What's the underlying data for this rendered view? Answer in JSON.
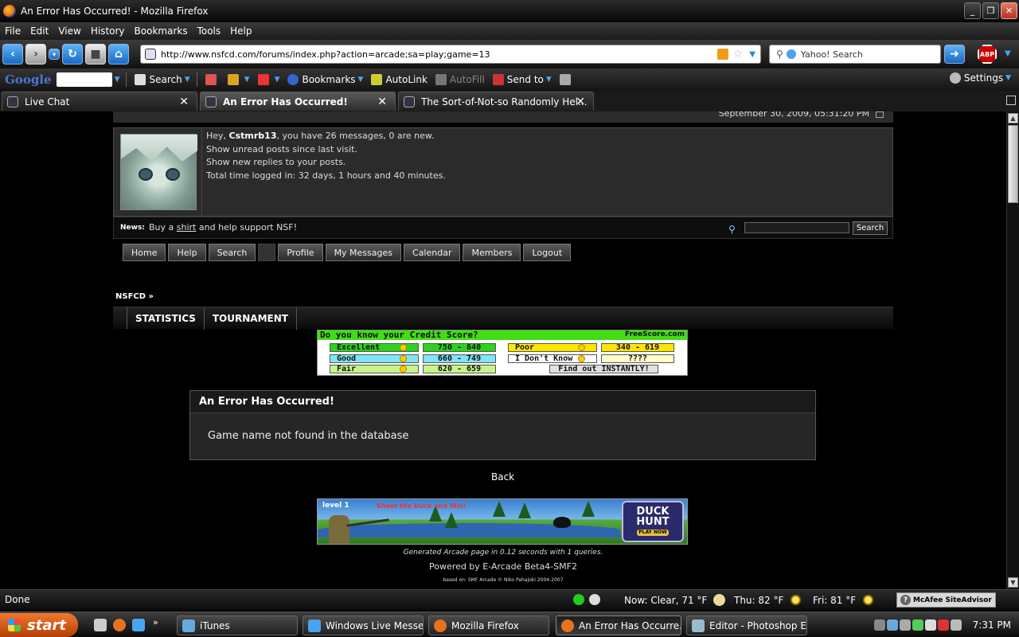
{
  "window": {
    "title": "An Error Has Occurred! - Mozilla Firefox"
  },
  "menu": [
    "File",
    "Edit",
    "View",
    "History",
    "Bookmarks",
    "Tools",
    "Help"
  ],
  "nav": {
    "url": "http://www.nsfcd.com/forums/index.php?action=arcade;sa=play;game=13",
    "search_placeholder": "Yahoo! Search"
  },
  "google_toolbar": {
    "logo": "Google",
    "search": "Search",
    "bookmarks": "Bookmarks",
    "autolink": "AutoLink",
    "autofill": "AutoFill",
    "sendto": "Send to",
    "settings": "Settings"
  },
  "tabs": [
    {
      "label": "Live Chat",
      "active": false
    },
    {
      "label": "An Error Has Occurred!",
      "active": true
    },
    {
      "label": "The Sort-of-Not-so Randomly Hel...",
      "active": false
    }
  ],
  "forum": {
    "datetime": "September 30, 2009, 05:31:20 PM",
    "greeting_prefix": "Hey, ",
    "username": "Cstmrb13",
    "greeting_suffix": ", you have 26 messages, 0 are new.",
    "unread": "Show unread posts since last visit.",
    "replies": "Show new replies to your posts.",
    "time_logged": "Total time logged in: 32 days, 1 hours and 40 minutes.",
    "news_label": "News:",
    "news_pre": "Buy a ",
    "news_link": "shirt",
    "news_post": " and help support NSF!",
    "search_button": "Search",
    "menu": [
      "Home",
      "Help",
      "Search",
      "",
      "Profile",
      "My Messages",
      "Calendar",
      "Members",
      "Logout"
    ],
    "breadcrumb": "NSFCD »",
    "arcade_links": [
      "STATISTICS",
      "TOURNAMENT"
    ]
  },
  "credit_ad": {
    "question": "Do you know your Credit Score?",
    "brand": "FreeScore.com",
    "rows": [
      {
        "label": "Excellent",
        "range": "750 - 840",
        "label_color": "#2bd31c",
        "range_color": "#2bd31c"
      },
      {
        "label": "Good",
        "range": "660 - 749",
        "label_color": "#7fe6f7",
        "range_color": "#7fe6f7"
      },
      {
        "label": "Fair",
        "range": "620 - 659",
        "label_color": "#c6f587",
        "range_color": "#c6f587"
      }
    ],
    "rows_right": [
      {
        "label": "Poor",
        "range": "340 - 619",
        "label_color": "#ffe600",
        "range_color": "#ffe600"
      },
      {
        "label": "I Don't Know",
        "range": "????",
        "label_color": "#ffffff",
        "range_color": "#ffffc8"
      }
    ],
    "cta": "Find out INSTANTLY!"
  },
  "error": {
    "title": "An Error Has Occurred!",
    "message": "Game name not found in the database",
    "back": "Back"
  },
  "duck_ad": {
    "level": "level 1",
    "tagline": "Shoot the Duck and Win!",
    "logo_line1": "DUCK",
    "logo_line2": "HUNT",
    "cta": "PLAY NOW"
  },
  "footer": {
    "generated": "Generated Arcade page in 0.12 seconds with 1 queries.",
    "powered": "Powered by E-Arcade Beta4-SMF2",
    "based": "based on: SMF Arcade © Niko Pahajoki 2004-2007"
  },
  "statusbar": {
    "status": "Done",
    "weather_now": "Now: Clear, 71 °F",
    "weather_thu": "Thu: 82 °F",
    "weather_fri": "Fri: 81 °F",
    "mcafee": "McAfee SiteAdvisor"
  },
  "taskbar": {
    "start": "start",
    "tasks": [
      {
        "label": "iTunes",
        "active": false
      },
      {
        "label": "Windows Live Messen...",
        "active": false
      },
      {
        "label": "Mozilla Firefox",
        "active": false
      },
      {
        "label": "An Error Has Occurre...",
        "active": true
      },
      {
        "label": "Editor - Photoshop El...",
        "active": false
      }
    ],
    "clock": "7:31 PM"
  },
  "colors": {
    "accent": "#1769c4",
    "ad_green": "#42dd17",
    "start_orange": "#e06418"
  }
}
